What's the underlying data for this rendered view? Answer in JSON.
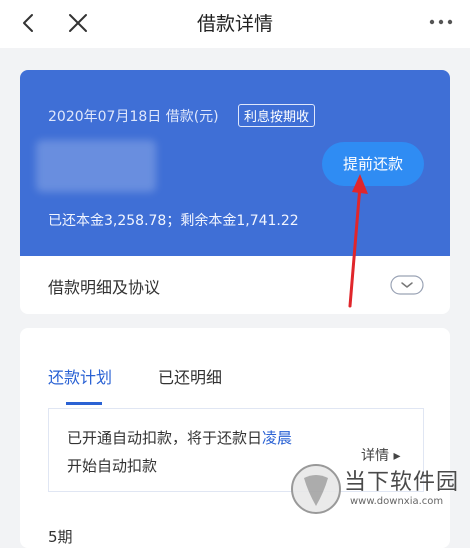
{
  "header": {
    "title": "借款详情"
  },
  "loan_card": {
    "date_text": "2020年07月18日 借款(元)",
    "tag": "利息按期收",
    "prepay_label": "提前还款",
    "principal_text": "已还本金3,258.78；剩余本金1,741.22",
    "detail_label": "借款明细及协议"
  },
  "plan_card": {
    "tabs": [
      {
        "label": "还款计划"
      },
      {
        "label": "已还明细"
      }
    ],
    "autopay_line1_pre": "已开通自动扣款，将于还款日",
    "autopay_line1_highlight": "凌晨",
    "autopay_line2": "开始自动扣款",
    "detail_link": "详情 ▸",
    "bottom_peek": "5期"
  },
  "watermark": {
    "brand": "当下软件园",
    "url": "www.downxia.com"
  },
  "colors": {
    "blue_card": "#3f6fd6",
    "button": "#2f8cf3",
    "accent": "#2a62d4",
    "annotation": "#e0262b"
  }
}
